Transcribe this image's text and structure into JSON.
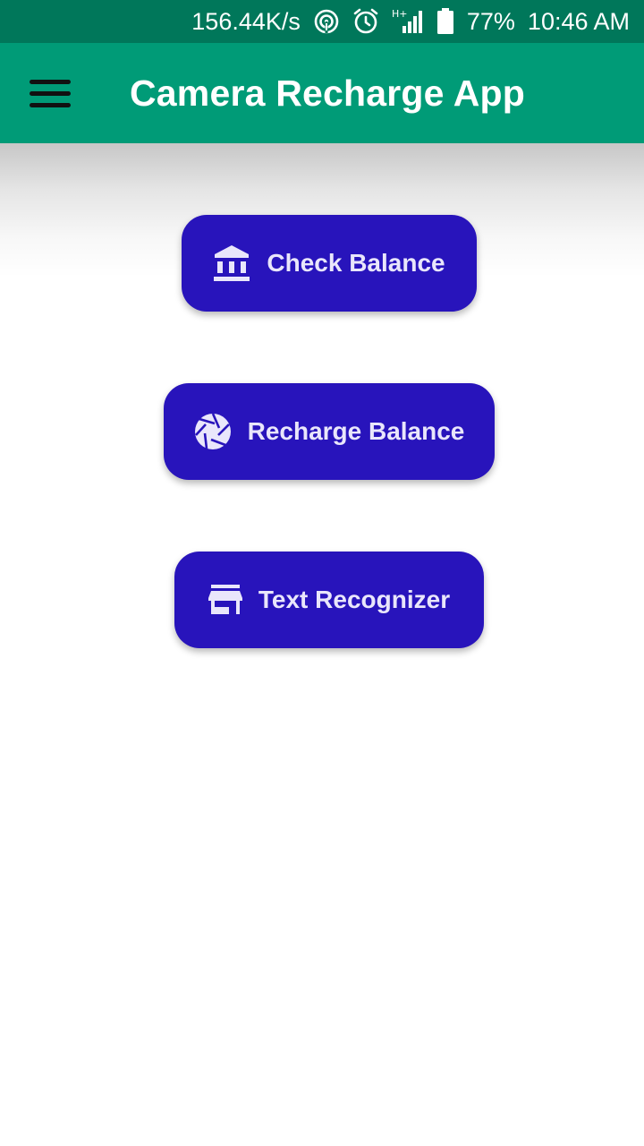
{
  "status_bar": {
    "network_speed": "156.44K/s",
    "hotspot_icon": "hotspot-icon",
    "alarm_icon": "alarm-icon",
    "signal_icon": "signal-icon",
    "battery_icon": "battery-icon",
    "battery_percent": "77%",
    "time": "10:46 AM"
  },
  "app_bar": {
    "menu_icon": "menu-icon",
    "title": "Camera Recharge App"
  },
  "colors": {
    "status_bar_bg": "#00775a",
    "app_bar_bg": "#009b77",
    "button_bg": "#2814bb",
    "button_text": "#e9e6fb"
  },
  "buttons": [
    {
      "label": "Check Balance",
      "icon": "bank-icon"
    },
    {
      "label": "Recharge Balance",
      "icon": "camera-shutter-icon"
    },
    {
      "label": "Text Recognizer",
      "icon": "store-icon"
    }
  ]
}
